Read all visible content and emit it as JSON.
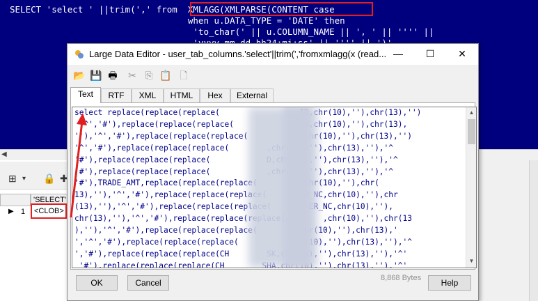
{
  "sql_editor": {
    "lines": [
      "SELECT 'select ' ||trim(',' from  XMLAGG(XMLPARSE(CONTENT case",
      "                                  when u.DATA_TYPE = 'DATE' then",
      "                                   'to_char(' || u.COLUMN_NAME || ', ' || '''' ||",
      "                                   'yyyy-mm-dd hh24:mi:ss' || '''' || ')'"
    ]
  },
  "grid": {
    "column_header": "'SELECT'|",
    "row_number": "1",
    "cell_value": "<CLOB>"
  },
  "dialog": {
    "title": "Large Data Editor - user_tab_columns.'select'||trim(','fromxmlagg(x (read...",
    "minimize": "—",
    "maximize": "☐",
    "close": "✕",
    "toolbar": {
      "open_icon": "📂",
      "save_icon": "💾",
      "print_icon": "🖶",
      "cut_icon": "✂",
      "copy_icon": "⎘",
      "paste_icon": "📋",
      "clear_icon": "🗋"
    },
    "tabs": [
      "Text",
      "RTF",
      "XML",
      "HTML",
      "Hex",
      "External"
    ],
    "active_tab": "Text",
    "content_lines": [
      "select replace(replace(replace(                 ID,chr(10),''),chr(13),'')",
      " '^','#'),replace(replace(replace(               D,chr(10),''),chr(13),",
      "''),'^','#'),replace(replace(replace(          E,chr(10),''),chr(13),'')",
      "'^','#'),replace(replace(replace(        ,chr(10),''),chr(13),''),'^",
      "'#'),replace(replace(replace(            D,chr(10),''),chr(13),''),'^",
      "'#'),replace(replace(replace(            ,chr(10),''),chr(13),''),'^",
      "'#'),TRADE_AMT,replace(replace(replace(       NC,chr(10),''),chr(",
      "13),''),'^','#'),replace(replace(replace(        R_NC,chr(10),''),chr",
      "(13),''),'^','#'),replace(replace(replace(        ER_NC,chr(10),''),",
      "chr(13),''),'^','#'),replace(replace(replace(        ,chr(10),''),chr(13",
      "),''),'^','#'),replace(replace(replace(        ,chr(10),''),chr(13),'",
      "','^','#'),replace(replace(replace(          ,chr(10),''),chr(13),''),'^",
      "','#'),replace(replace(replace(CH        SK,chr(10),''),chr(13),''),'^'",
      " '#'),replace(replace(replace(CH        SHA,chr(10),''),chr(13),''),'^'"
    ],
    "byte_count": "8,868 Bytes",
    "ok_label": "OK",
    "cancel_label": "Cancel",
    "help_label": "Help"
  },
  "colors": {
    "sql_background": "#00007f",
    "code_text": "#00008b",
    "annotation_red": "#e02020"
  }
}
